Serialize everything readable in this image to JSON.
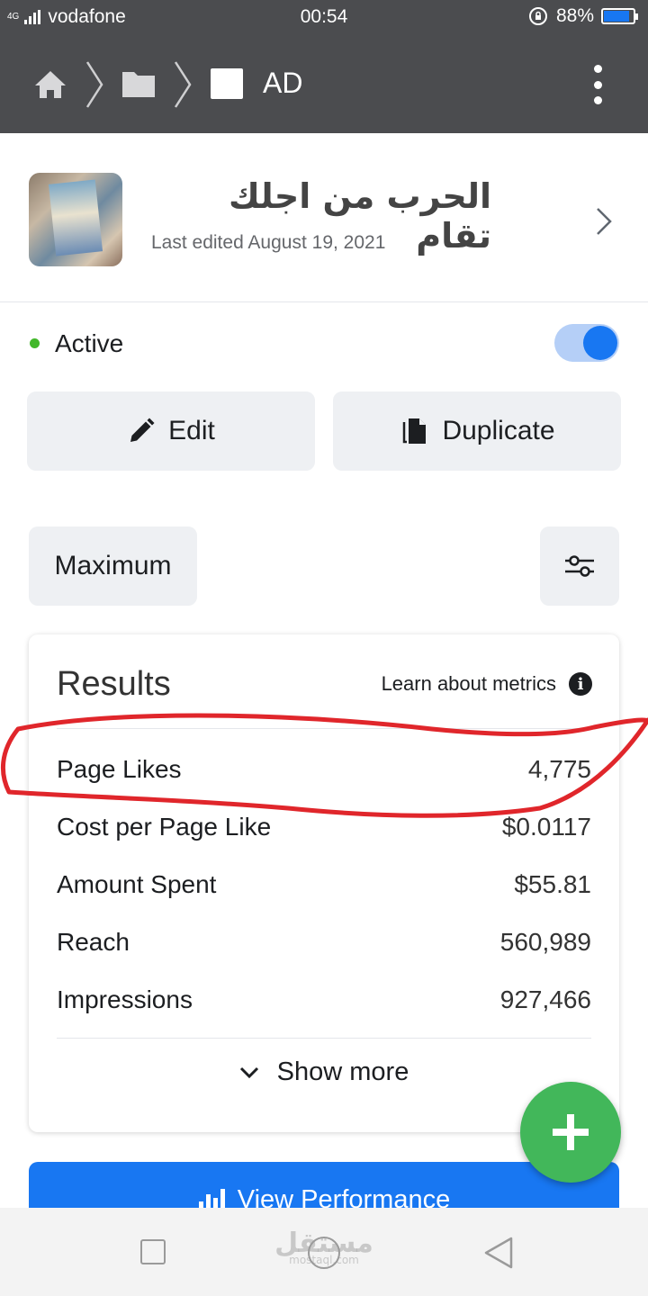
{
  "status_bar": {
    "network": "4G",
    "carrier": "vodafone",
    "time": "00:54",
    "battery_percent": "88%",
    "battery_level": 0.88,
    "battery_color": "#1877f2"
  },
  "nav": {
    "title": "AD",
    "icons": [
      "home-icon",
      "chevron-right-icon",
      "folder-icon",
      "chevron-right-icon",
      "ad-square-icon",
      "more-vertical-icon"
    ]
  },
  "ad": {
    "name": "الحرب من اجلك تقام",
    "last_edited": "Last edited August 19, 2021"
  },
  "status": {
    "label": "Active",
    "dot_color": "#42b72a",
    "toggle_on": true
  },
  "actions": {
    "edit_label": "Edit",
    "duplicate_label": "Duplicate"
  },
  "filter": {
    "range_label": "Maximum"
  },
  "results": {
    "title": "Results",
    "learn_label": "Learn about metrics",
    "metrics": [
      {
        "name": "Page Likes",
        "value": "4,775"
      },
      {
        "name": "Cost per Page Like",
        "value": "$0.0117"
      },
      {
        "name": "Amount Spent",
        "value": "$55.81"
      },
      {
        "name": "Reach",
        "value": "560,989"
      },
      {
        "name": "Impressions",
        "value": "927,466"
      }
    ],
    "show_more_label": "Show more"
  },
  "view_performance_label": "View Performance",
  "colors": {
    "accent": "#1877f2",
    "fab": "#42b75a",
    "annotation": "#e0262b",
    "header": "#4b4c4f"
  },
  "watermark": {
    "arabic": "مستقل",
    "latin": "mostaql.com"
  }
}
